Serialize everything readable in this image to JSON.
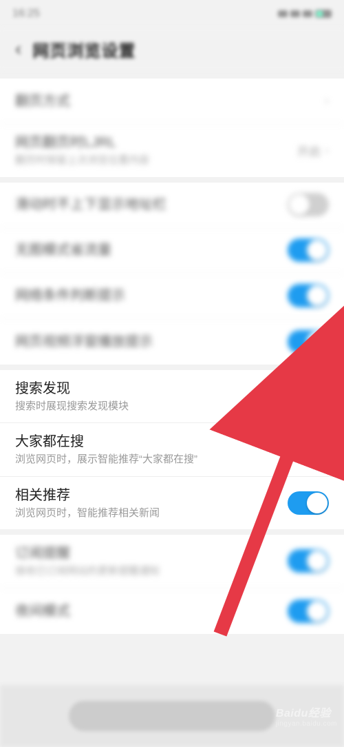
{
  "status": {
    "time": "16:25"
  },
  "header": {
    "title": "网页浏览设置",
    "back_glyph": "‹"
  },
  "group1": {
    "row1": {
      "label": "翻页方式",
      "chevron": "›"
    },
    "row2": {
      "label": "网页翻页时LJRL",
      "sub": "翻页时保留上次浏览位置内容",
      "right": "开启"
    }
  },
  "group2": {
    "row1": {
      "label": "滑动时不上下显示地址栏",
      "on": false
    },
    "row2": {
      "label": "无图模式省流量",
      "on": true
    },
    "row3": {
      "label": "网络条件判断提示",
      "on": true
    },
    "row4": {
      "label": "网页视频浮窗播放提示",
      "on": true
    }
  },
  "group3": {
    "row1": {
      "label": "搜索发现",
      "sub": "搜索时展现搜索发现模块",
      "on": false
    },
    "row2": {
      "label": "大家都在搜",
      "sub": "浏览网页时，展示智能推荐“大家都在搜”",
      "on": true
    },
    "row3": {
      "label": "相关推荐",
      "sub": "浏览网页时，智能推荐相关新闻",
      "on": true
    }
  },
  "group4": {
    "row1": {
      "label": "订阅提醒",
      "sub": "接收已订阅网站的更新提醒通知",
      "on": true
    },
    "row2": {
      "label": "夜间模式",
      "on": true
    }
  },
  "watermark": {
    "brand": "Baidu经验",
    "url": "jingyan.baidu.com"
  }
}
